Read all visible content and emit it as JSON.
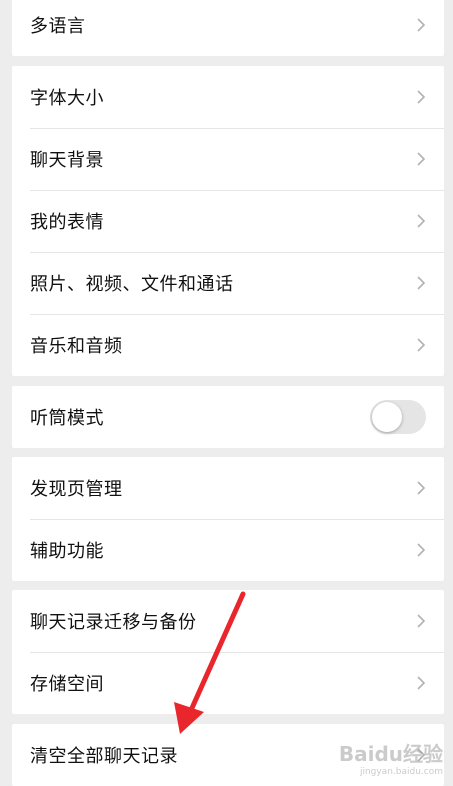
{
  "settings": {
    "group0": {
      "items": [
        {
          "label": "多语言"
        }
      ]
    },
    "group1": {
      "items": [
        {
          "label": "字体大小"
        },
        {
          "label": "聊天背景"
        },
        {
          "label": "我的表情"
        },
        {
          "label": "照片、视频、文件和通话"
        },
        {
          "label": "音乐和音频"
        }
      ]
    },
    "group2": {
      "items": [
        {
          "label": "听筒模式",
          "toggle_on": false
        }
      ]
    },
    "group3": {
      "items": [
        {
          "label": "发现页管理"
        },
        {
          "label": "辅助功能"
        }
      ]
    },
    "group4": {
      "items": [
        {
          "label": "聊天记录迁移与备份"
        },
        {
          "label": "存储空间"
        }
      ]
    },
    "group5": {
      "items": [
        {
          "label": "清空全部聊天记录"
        }
      ]
    }
  },
  "icons": {
    "row_chevron": "chevron-right-icon",
    "annotation": "arrow-icon"
  },
  "colors": {
    "background": "#ededed",
    "card": "#ffffff",
    "arrow": "#e8262c",
    "toggle_off": "#e5e5e5"
  },
  "watermark": {
    "brand": "Baidu经验",
    "url": "jingyan.baidu.com"
  }
}
